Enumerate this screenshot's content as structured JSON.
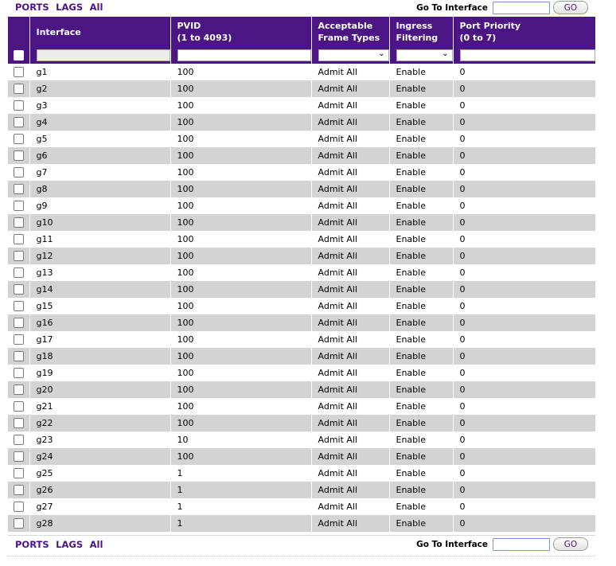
{
  "nav": {
    "links": [
      "PORTS",
      "LAGS",
      "All"
    ],
    "goto_label": "Go To Interface",
    "goto_value": "",
    "go_label": "GO"
  },
  "table": {
    "headers": {
      "interface": "Interface",
      "pvid_line1": "PVID",
      "pvid_line2": "(1 to 4093)",
      "frame_line1": "Acceptable",
      "frame_line2": "Frame Types",
      "ingress_line1": "Ingress",
      "ingress_line2": "Filtering",
      "priority_line1": "Port Priority",
      "priority_line2": "(0 to 7)"
    },
    "filter": {
      "interface": "",
      "pvid": "",
      "frame_types": "",
      "ingress": "",
      "priority": ""
    },
    "rows": [
      {
        "interface": "g1",
        "pvid": "100",
        "frame_types": "Admit All",
        "ingress": "Enable",
        "priority": "0"
      },
      {
        "interface": "g2",
        "pvid": "100",
        "frame_types": "Admit All",
        "ingress": "Enable",
        "priority": "0"
      },
      {
        "interface": "g3",
        "pvid": "100",
        "frame_types": "Admit All",
        "ingress": "Enable",
        "priority": "0"
      },
      {
        "interface": "g4",
        "pvid": "100",
        "frame_types": "Admit All",
        "ingress": "Enable",
        "priority": "0"
      },
      {
        "interface": "g5",
        "pvid": "100",
        "frame_types": "Admit All",
        "ingress": "Enable",
        "priority": "0"
      },
      {
        "interface": "g6",
        "pvid": "100",
        "frame_types": "Admit All",
        "ingress": "Enable",
        "priority": "0"
      },
      {
        "interface": "g7",
        "pvid": "100",
        "frame_types": "Admit All",
        "ingress": "Enable",
        "priority": "0"
      },
      {
        "interface": "g8",
        "pvid": "100",
        "frame_types": "Admit All",
        "ingress": "Enable",
        "priority": "0"
      },
      {
        "interface": "g9",
        "pvid": "100",
        "frame_types": "Admit All",
        "ingress": "Enable",
        "priority": "0"
      },
      {
        "interface": "g10",
        "pvid": "100",
        "frame_types": "Admit All",
        "ingress": "Enable",
        "priority": "0"
      },
      {
        "interface": "g11",
        "pvid": "100",
        "frame_types": "Admit All",
        "ingress": "Enable",
        "priority": "0"
      },
      {
        "interface": "g12",
        "pvid": "100",
        "frame_types": "Admit All",
        "ingress": "Enable",
        "priority": "0"
      },
      {
        "interface": "g13",
        "pvid": "100",
        "frame_types": "Admit All",
        "ingress": "Enable",
        "priority": "0"
      },
      {
        "interface": "g14",
        "pvid": "100",
        "frame_types": "Admit All",
        "ingress": "Enable",
        "priority": "0"
      },
      {
        "interface": "g15",
        "pvid": "100",
        "frame_types": "Admit All",
        "ingress": "Enable",
        "priority": "0"
      },
      {
        "interface": "g16",
        "pvid": "100",
        "frame_types": "Admit All",
        "ingress": "Enable",
        "priority": "0"
      },
      {
        "interface": "g17",
        "pvid": "100",
        "frame_types": "Admit All",
        "ingress": "Enable",
        "priority": "0"
      },
      {
        "interface": "g18",
        "pvid": "100",
        "frame_types": "Admit All",
        "ingress": "Enable",
        "priority": "0"
      },
      {
        "interface": "g19",
        "pvid": "100",
        "frame_types": "Admit All",
        "ingress": "Enable",
        "priority": "0"
      },
      {
        "interface": "g20",
        "pvid": "100",
        "frame_types": "Admit All",
        "ingress": "Enable",
        "priority": "0"
      },
      {
        "interface": "g21",
        "pvid": "100",
        "frame_types": "Admit All",
        "ingress": "Enable",
        "priority": "0"
      },
      {
        "interface": "g22",
        "pvid": "100",
        "frame_types": "Admit All",
        "ingress": "Enable",
        "priority": "0"
      },
      {
        "interface": "g23",
        "pvid": "10",
        "frame_types": "Admit All",
        "ingress": "Enable",
        "priority": "0"
      },
      {
        "interface": "g24",
        "pvid": "100",
        "frame_types": "Admit All",
        "ingress": "Enable",
        "priority": "0"
      },
      {
        "interface": "g25",
        "pvid": "1",
        "frame_types": "Admit All",
        "ingress": "Enable",
        "priority": "0"
      },
      {
        "interface": "g26",
        "pvid": "1",
        "frame_types": "Admit All",
        "ingress": "Enable",
        "priority": "0"
      },
      {
        "interface": "g27",
        "pvid": "1",
        "frame_types": "Admit All",
        "ingress": "Enable",
        "priority": "0"
      },
      {
        "interface": "g28",
        "pvid": "1",
        "frame_types": "Admit All",
        "ingress": "Enable",
        "priority": "0"
      }
    ]
  }
}
